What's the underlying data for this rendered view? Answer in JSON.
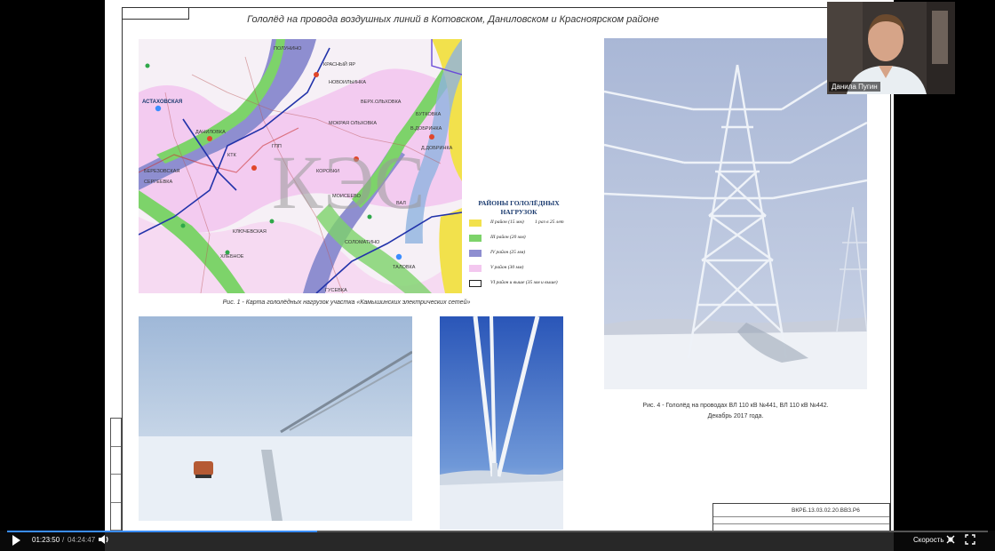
{
  "document": {
    "title": "Гололёд на провода воздушных линий в Котовском, Даниловском и Красноярском районе",
    "watermark": "КЭС",
    "map_caption": "Рис. 1 - Карта гололёдных нагрузок участка «Камышинских электрических сетей»",
    "photo4_caption_line1": "Рис. 4 - Гололёд на проводах ВЛ 110 кВ №441, ВЛ 110 кВ №442.",
    "photo4_caption_line2": "Декабрь 2017 года.",
    "drawing_code": "ВКРБ.13.03.02.20.ВВЗ.Р6"
  },
  "map_labels": {
    "astakhovskaya": "АСТАХОВСКАЯ",
    "danilovka": "ДАНИЛОВКА",
    "berezovskaya": "БЕРЕЗОВСКАЯ",
    "sergeevka": "СЕРГЕЕВКА",
    "krasny_yar": "КРАСНЫЙ ЯР",
    "novoolshanka": "НОВОИЛЬИНКА",
    "volga_olkhovka": "ВЕРХ.ОЛЬХОВКА",
    "korobki": "КОРОБКИ",
    "moiseevo": "МОИСЕЕВО",
    "solomatino": "СОЛОМАТИНО",
    "talovka": "ТАЛОВКА",
    "guseva": "ГУСЕВКА",
    "butkovka": "БУТКОВКА",
    "dobrinka": "Д.ДОБРИНКА",
    "khlebnoe": "ХЛЕБНОЕ",
    "klyuchevskaya": "КЛЮЧЕВСКАЯ",
    "mokraya": "МОКРАЯ ОЛЬХОВКА",
    "polunino": "ПОЛУНИНО",
    "rudnya": "В.ДОБРИНКА",
    "ktk": "КТК",
    "gpp": "ГПП",
    "val": "ВАЛ"
  },
  "legend": {
    "title_line1": "РАЙОНЫ ГОЛОЛЁДНЫХ",
    "title_line2": "НАГРУЗОК",
    "rows": [
      {
        "label": "II район (15 мм)",
        "note": "1 раз в 25 лет",
        "color": "#f2e14c",
        "border": "#f2e14c"
      },
      {
        "label": "III район (20 мм)",
        "note": "",
        "color": "#7dd36a",
        "border": "#7dd36a"
      },
      {
        "label": "IV район (25 мм)",
        "note": "",
        "color": "#8e8ed0",
        "border": "#8e8ed0"
      },
      {
        "label": "V район (30 мм)",
        "note": "",
        "color": "#f3c7ef",
        "border": "#f3c7ef"
      },
      {
        "label": "VI район и выше (35 мм и выше)",
        "note": "",
        "color": "#ffffff",
        "border": "#222222"
      }
    ]
  },
  "webcam": {
    "name": "Данила Пугин"
  },
  "player": {
    "current_time": "01:23:50",
    "total_time": "04:24:47",
    "time_separator": "/",
    "progress": 0.316,
    "speed_label": "Скорость",
    "accent_color": "#3a8dff",
    "icons": [
      "play-icon",
      "volume-icon",
      "settings-icon",
      "fullscreen-icon"
    ]
  }
}
